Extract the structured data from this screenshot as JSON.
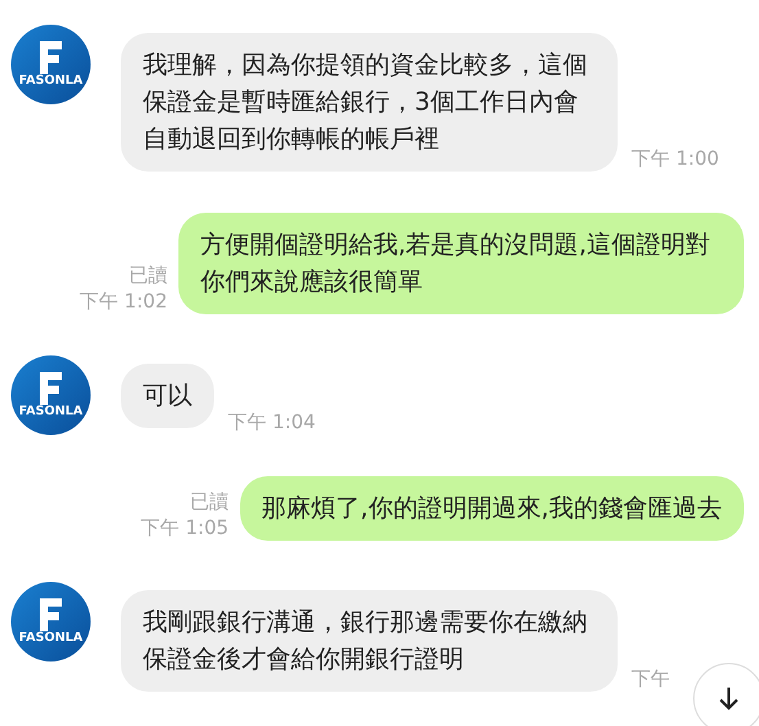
{
  "messages": [
    {
      "kind": "incoming",
      "avatar": "FASONLA",
      "text": "我理解，因為你提領的資金比較多，這個保證金是暫時匯給銀行，3個工作日內會自動退回到你轉帳的帳戶裡",
      "time": "下午 1:00"
    },
    {
      "kind": "outgoing",
      "read": "已讀",
      "text": "方便開個證明給我,若是真的沒問題,這個證明對你們來說應該很簡單",
      "time": "下午 1:02"
    },
    {
      "kind": "incoming",
      "avatar": "FASONLA",
      "text": "可以",
      "time": "下午 1:04"
    },
    {
      "kind": "outgoing",
      "read": "已讀",
      "text": "那麻煩了,你的證明開過來,我的錢會匯過去",
      "time": "下午 1:05"
    },
    {
      "kind": "incoming",
      "avatar": "FASONLA",
      "text": "我剛跟銀行溝通，銀行那邊需要你在繳納保證金後才會給你開銀行證明",
      "time": "下午"
    }
  ]
}
